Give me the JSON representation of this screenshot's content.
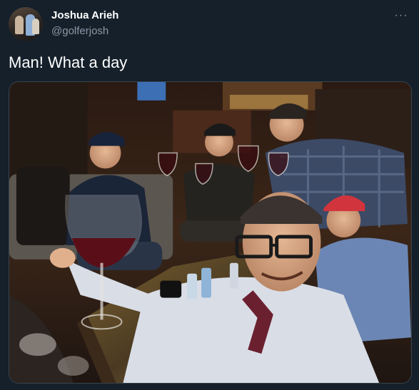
{
  "tweet": {
    "author": {
      "display_name": "Joshua Arieh",
      "handle": "@golferjosh",
      "avatar_icon": "profile-photo"
    },
    "more_icon": "more-options-icon",
    "more_glyph": "···",
    "text": "Man! What a day",
    "media": {
      "type": "photo",
      "caption_description": ""
    }
  },
  "colors": {
    "background": "#15202b",
    "primary_text": "#ffffff",
    "secondary_text": "#8b98a5",
    "border": "#38444d"
  }
}
